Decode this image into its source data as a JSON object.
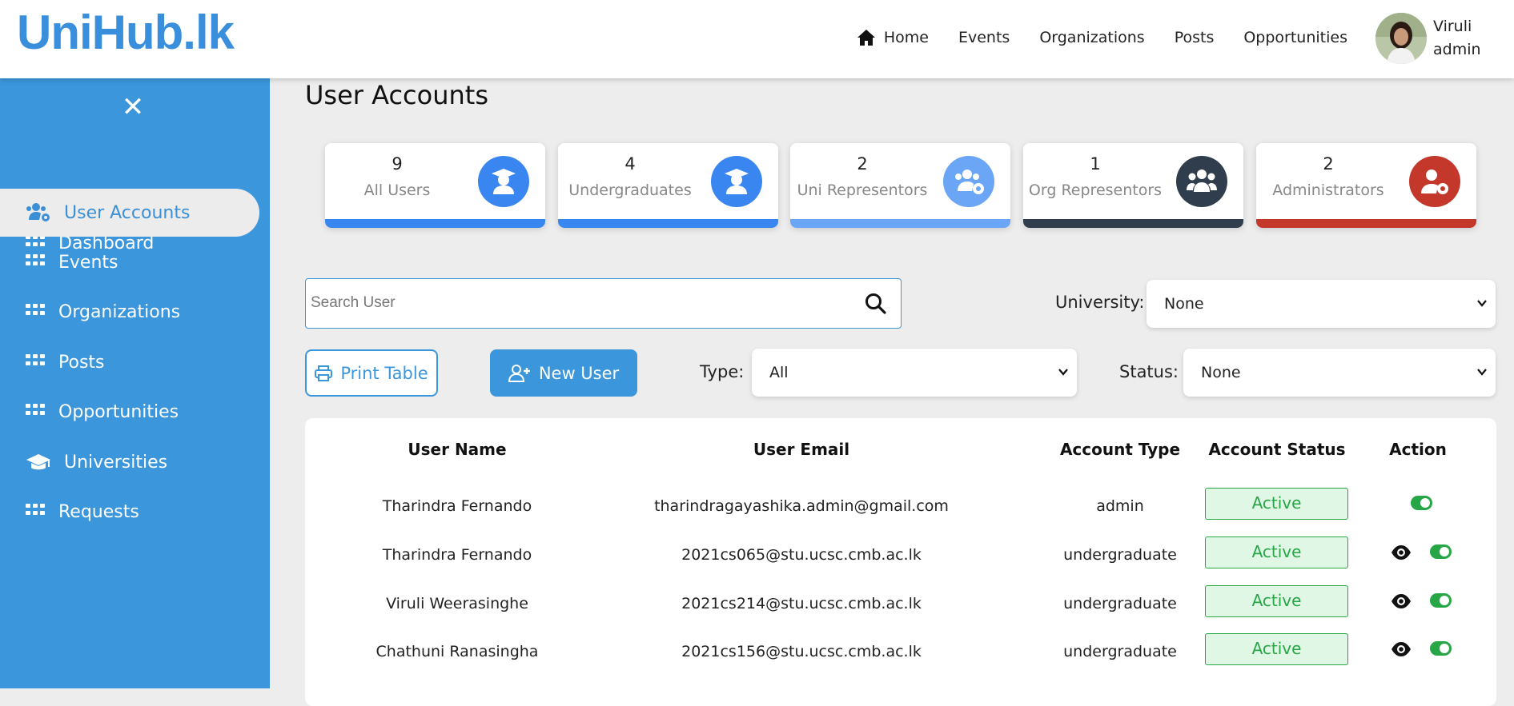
{
  "app": {
    "logo": "UniHub.lk"
  },
  "nav": {
    "items": [
      "Home",
      "Events",
      "Organizations",
      "Posts",
      "Opportunities"
    ]
  },
  "user": {
    "name": "Viruli",
    "role": "admin"
  },
  "sidebar": {
    "items": [
      {
        "label": "Dashboard",
        "icon": "grid-icon"
      },
      {
        "label": "User Accounts",
        "icon": "users-cog-icon"
      },
      {
        "label": "Events",
        "icon": "grid-icon"
      },
      {
        "label": "Organizations",
        "icon": "grid-icon"
      },
      {
        "label": "Posts",
        "icon": "grid-icon"
      },
      {
        "label": "Opportunities",
        "icon": "grid-icon"
      },
      {
        "label": "Universities",
        "icon": "graduation-cap-icon"
      },
      {
        "label": "Requests",
        "icon": "grid-icon"
      }
    ],
    "active": "User Accounts"
  },
  "page": {
    "title": "User Accounts"
  },
  "cards": [
    {
      "count": "9",
      "label": "All Users",
      "color": "#3a86f0",
      "icon": "user-graduate-icon"
    },
    {
      "count": "4",
      "label": "Undergraduates",
      "color": "#3a86f0",
      "icon": "user-graduate-icon"
    },
    {
      "count": "2",
      "label": "Uni Representors",
      "color": "#6aa6f5",
      "icon": "users-cog-icon"
    },
    {
      "count": "1",
      "label": "Org Representors",
      "color": "#2f3d4d",
      "icon": "users-icon"
    },
    {
      "count": "2",
      "label": "Administrators",
      "color": "#c4382c",
      "icon": "user-cog-icon"
    }
  ],
  "search": {
    "placeholder": "Search User"
  },
  "filters": {
    "university_label": "University:",
    "university_value": "None",
    "type_label": "Type:",
    "type_value": "All",
    "status_label": "Status:",
    "status_value": "None"
  },
  "buttons": {
    "print": "Print Table",
    "new_user": "New User"
  },
  "table": {
    "headers": [
      "User Name",
      "User Email",
      "Account Type",
      "Account Status",
      "Action"
    ],
    "rows": [
      {
        "name": "Tharindra Fernando",
        "email": "tharindragayashika.admin@gmail.com",
        "type": "admin",
        "status": "Active",
        "view": false
      },
      {
        "name": "Tharindra Fernando",
        "email": "2021cs065@stu.ucsc.cmb.ac.lk",
        "type": "undergraduate",
        "status": "Active",
        "view": true
      },
      {
        "name": "Viruli Weerasinghe",
        "email": "2021cs214@stu.ucsc.cmb.ac.lk",
        "type": "undergraduate",
        "status": "Active",
        "view": true
      },
      {
        "name": "Chathuni Ranasingha",
        "email": "2021cs156@stu.ucsc.cmb.ac.lk",
        "type": "undergraduate",
        "status": "Active",
        "view": true
      }
    ]
  },
  "colors": {
    "primary": "#3b96dc",
    "active_green": "#27a646"
  }
}
